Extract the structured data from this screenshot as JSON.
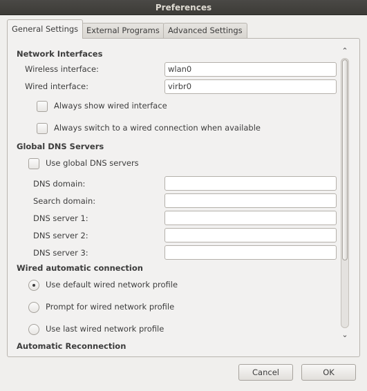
{
  "window": {
    "title": "Preferences"
  },
  "tabs": [
    {
      "label": "General Settings"
    },
    {
      "label": "External Programs"
    },
    {
      "label": "Advanced Settings"
    }
  ],
  "network_interfaces": {
    "heading": "Network Interfaces",
    "wireless_label": "Wireless interface:",
    "wireless_value": "wlan0",
    "wired_label": "Wired interface:",
    "wired_value": "virbr0",
    "always_show_wired": {
      "label": "Always show wired interface",
      "checked": false
    },
    "always_switch_wired": {
      "label": "Always switch to a wired connection when available",
      "checked": false
    }
  },
  "global_dns": {
    "heading": "Global DNS Servers",
    "use_global": {
      "label": "Use global DNS servers",
      "checked": false
    },
    "fields": [
      {
        "label": "DNS domain:",
        "value": ""
      },
      {
        "label": "Search domain:",
        "value": ""
      },
      {
        "label": "DNS server 1:",
        "value": ""
      },
      {
        "label": "DNS server 2:",
        "value": ""
      },
      {
        "label": "DNS server 3:",
        "value": ""
      }
    ]
  },
  "wired_auto": {
    "heading": "Wired automatic connection",
    "options": [
      {
        "label": "Use default wired network profile",
        "selected": true
      },
      {
        "label": "Prompt for wired network profile",
        "selected": false
      },
      {
        "label": "Use last wired network profile",
        "selected": false
      }
    ]
  },
  "next_section_heading": "Automatic Reconnection",
  "scrollbar": {
    "up_icon": "chevron-up-icon",
    "down_icon": "chevron-down-icon",
    "position": 0
  },
  "buttons": {
    "cancel": "Cancel",
    "ok": "OK"
  }
}
